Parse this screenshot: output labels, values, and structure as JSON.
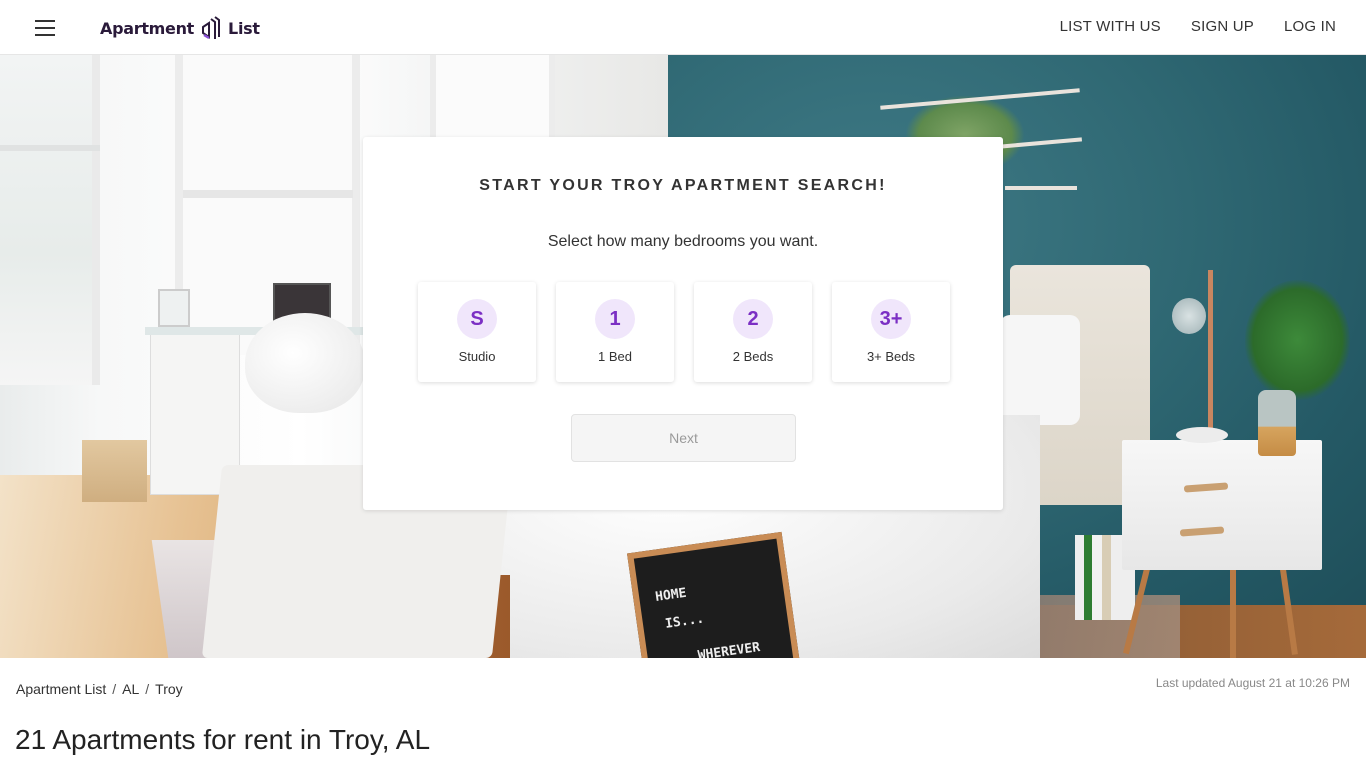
{
  "header": {
    "logo": {
      "text_left": "Apartment",
      "text_right": "List",
      "icon": "apartment-list-logo-icon"
    },
    "menu_icon": "hamburger-menu-icon",
    "nav": [
      {
        "label": "LIST WITH US"
      },
      {
        "label": "SIGN UP"
      },
      {
        "label": "LOG IN"
      }
    ]
  },
  "hero": {
    "image_description": "Bright bedroom with white windows, teal wall, bed, nightstand and letter board",
    "letterboard_text": [
      "HOME",
      "IS...",
      "WHEREVER"
    ]
  },
  "search_card": {
    "title": "START YOUR TROY APARTMENT SEARCH!",
    "subtitle": "Select how many bedrooms you want.",
    "options": [
      {
        "badge": "S",
        "label": "Studio"
      },
      {
        "badge": "1",
        "label": "1 Bed"
      },
      {
        "badge": "2",
        "label": "2 Beds"
      },
      {
        "badge": "3+",
        "label": "3+ Beds"
      }
    ],
    "next_label": "Next",
    "next_disabled": true
  },
  "breadcrumb": {
    "items": [
      {
        "label": "Apartment List"
      },
      {
        "label": "AL"
      },
      {
        "label": "Troy"
      }
    ],
    "separator": "/"
  },
  "last_updated": "Last updated August 21 at 10:26 PM",
  "page_title": "21 Apartments for rent in Troy, AL",
  "colors": {
    "accent_purple": "#7b2fc4",
    "badge_bg": "#f0e6fb",
    "logo_dark": "#2a1a3a",
    "teal_wall": "#2f6873"
  }
}
